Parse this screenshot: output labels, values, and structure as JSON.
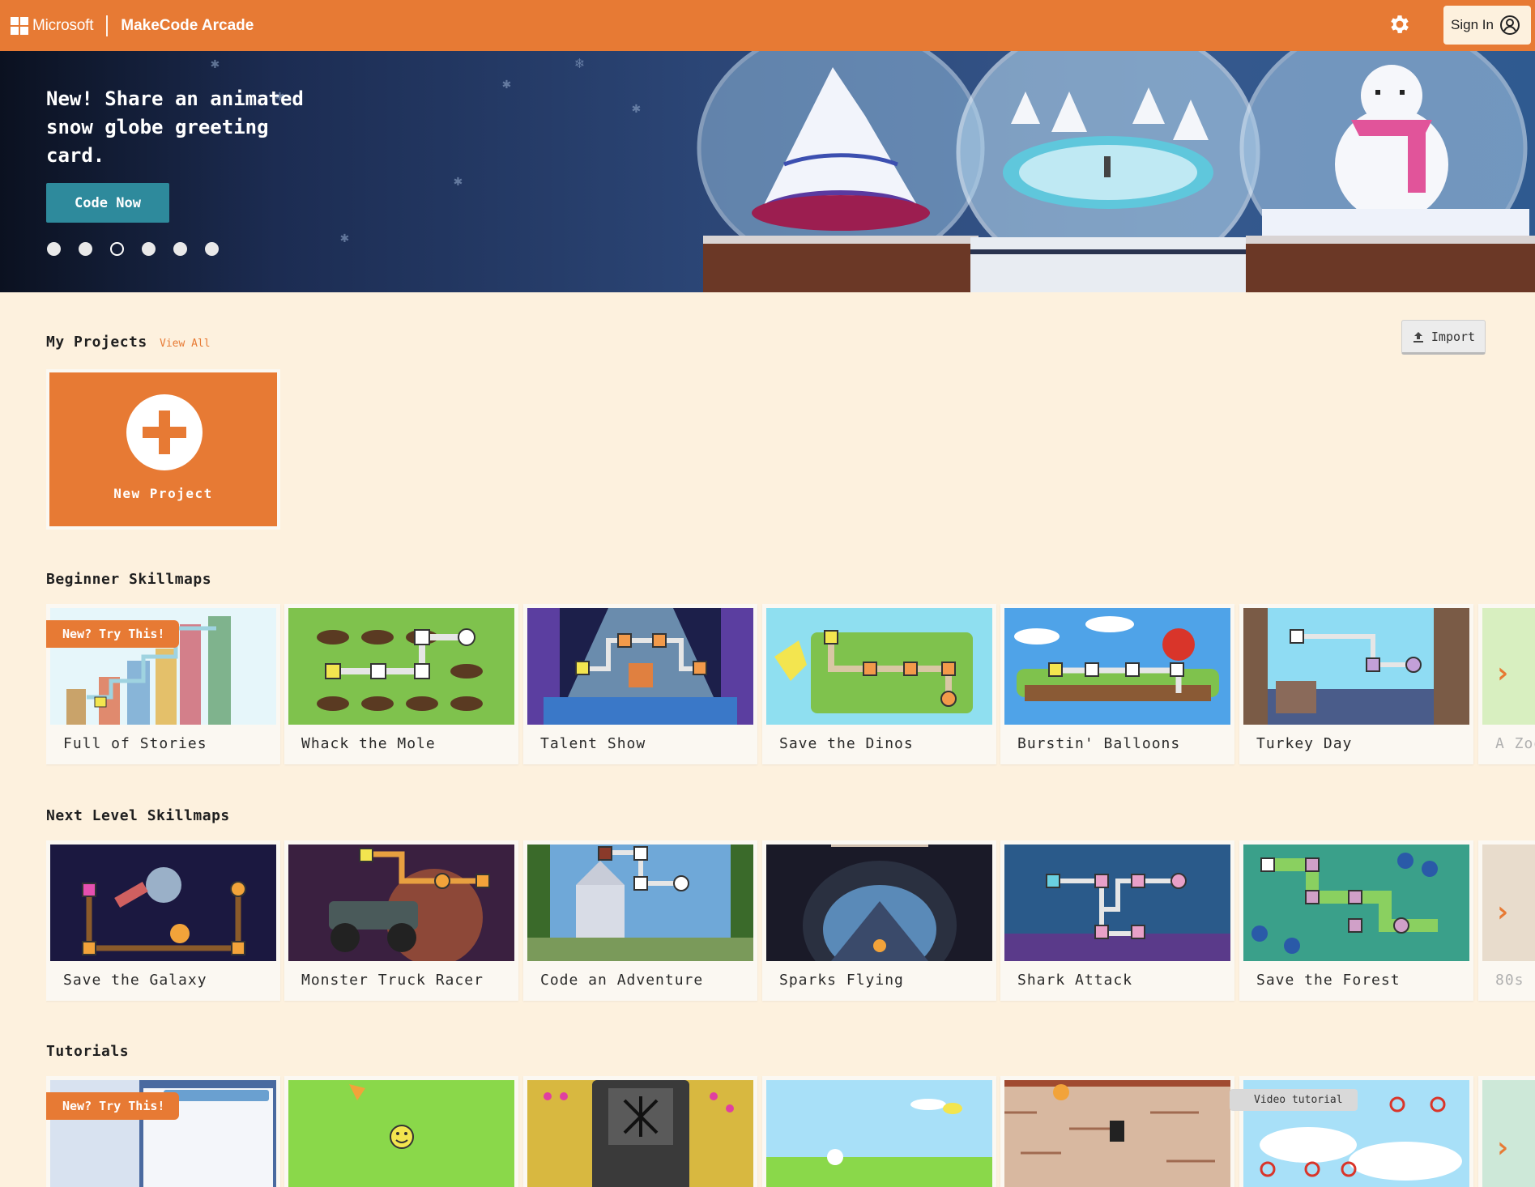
{
  "header": {
    "brand": "Microsoft",
    "app_title": "MakeCode Arcade",
    "sign_in_label": "Sign In",
    "accent_color": "#e77a34"
  },
  "hero": {
    "title": "New! Share an animated snow globe greeting card.",
    "cta_label": "Code Now",
    "slide_count": 6,
    "active_slide": 3
  },
  "my_projects": {
    "title": "My Projects",
    "view_all": "View All",
    "import_label": "Import",
    "new_project_label": "New Project"
  },
  "beginner": {
    "title": "Beginner Skillmaps",
    "ribbon": "New? Try This!",
    "cards": [
      "Full of Stories",
      "Whack the Mole",
      "Talent Show",
      "Save the Dinos",
      "Burstin' Balloons",
      "Turkey Day",
      "A Zoo"
    ]
  },
  "next_level": {
    "title": "Next Level Skillmaps",
    "cards": [
      "Save the Galaxy",
      "Monster Truck Racer",
      "Code an Adventure",
      "Sparks Flying",
      "Shark Attack",
      "Save the Forest",
      "80s"
    ]
  },
  "tutorials": {
    "title": "Tutorials",
    "ribbon": "New? Try This!",
    "video_badge": "Video tutorial"
  }
}
